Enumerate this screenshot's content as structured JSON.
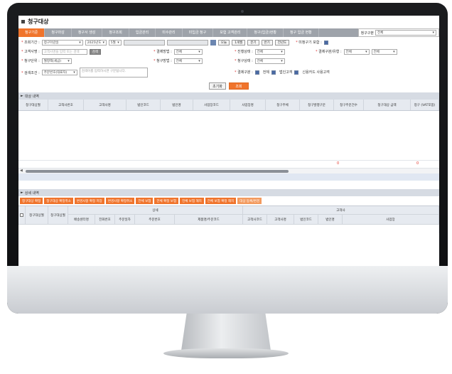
{
  "screen": {
    "title": "청구대상",
    "tabs": [
      {
        "label": "청구기준",
        "active": true
      },
      {
        "label": "청구마감",
        "active": false
      },
      {
        "label": "청구서 생성",
        "active": false
      },
      {
        "label": "청구조회",
        "active": false
      },
      {
        "label": "입금관리",
        "active": false
      },
      {
        "label": "미수관리",
        "active": false
      },
      {
        "label": "미입금 청구",
        "active": false
      },
      {
        "label": "보험 고객관리",
        "active": false
      },
      {
        "label": "청구(입금)현황",
        "active": false
      },
      {
        "label": "청구 입금 현황",
        "active": false
      }
    ],
    "tab_select": {
      "label": "청구구분",
      "value": "전체"
    }
  },
  "form": {
    "lookup_period": {
      "label": "조회기간",
      "type_value": "청구마감일",
      "year_value": "2025년도",
      "month_value": "5월",
      "from_placeholder": "",
      "to_placeholder": "",
      "btn_today": "오늘",
      "btn_1month": "1개월",
      "btn_quarter": "분기",
      "btn_half": "반기",
      "btn_year": "전년도"
    },
    "insured_check": {
      "label": "미청구기 포함"
    },
    "customer": {
      "label": "고객사명",
      "placeholder": "고객사명을 입력 또는 검색",
      "btn": "검색"
    },
    "claim_type": {
      "label": "결제방법",
      "value": "전체"
    },
    "claim_kind": {
      "label": "진행상태",
      "value": "전체"
    },
    "pay_type": {
      "label": "결제구분/유형",
      "value": "전체",
      "value2": "전체"
    },
    "claim_unit": {
      "label": "청구단위",
      "value": "월정액(세금)"
    },
    "claim_method": {
      "label": "청구방법",
      "value": "전체"
    },
    "claim_status": {
      "label": "청구상태",
      "value": "전체"
    },
    "search_cond": {
      "label": "검색조건",
      "value": "주문번호(대표자)",
      "placeholder": "검색어를 입력하시면 구분됩니다."
    },
    "settle": {
      "label": "결제구분",
      "opt1": "전체",
      "opt2": "법인고객",
      "opt3": "신용카드 사용고객"
    },
    "btn_reset": "초기화",
    "btn_search": "조회"
  },
  "target_list": {
    "title": "대상 내역",
    "columns": [
      "청구대상월",
      "고객사번호",
      "고객사명",
      "법인코드",
      "법인명",
      "사업장코드",
      "사업장명",
      "청구주체",
      "청구발행구분",
      "청구주문건수",
      "청구대상 금액",
      "청구 (VAT포함)"
    ],
    "total_1": "0",
    "total_2": "0"
  },
  "detail_list": {
    "title": "상세 내역",
    "buttons": [
      "청구대상 확정",
      "청구대상 확정취소",
      "변경사항 확정 저장",
      "변경사항 확정취소",
      "전체 보험",
      "전체 확정 보험",
      "전체 보험 해지",
      "전체 보험 확정 해지",
      "대상 등록/변경"
    ],
    "group_headers": {
      "customer": "상세",
      "biz": "고객사"
    },
    "columns": [
      "청구대상월",
      "청구대상월",
      "배송센터명",
      "전화번호",
      "주문일자",
      "주문번호",
      "제품명/주문코드",
      "고객사코드",
      "고객사명",
      "법인코드",
      "법인명",
      "사업장"
    ]
  }
}
